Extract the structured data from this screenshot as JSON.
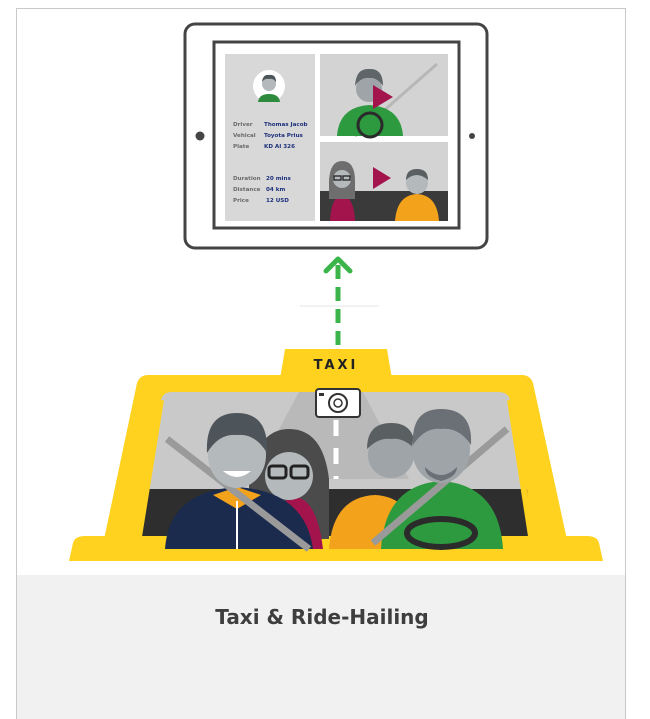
{
  "title": "Taxi & Ride-Hailing",
  "sign": "TAXI",
  "trip": {
    "driver_label": "Driver",
    "driver": "Thomas Jacob",
    "vehicle_label": "Vehical",
    "vehicle": "Toyota Prius",
    "plate_label": "Plate",
    "plate": "KD AI 326",
    "duration_label": "Duration",
    "duration": "20 mins",
    "distance_label": "Distance",
    "distance": "04 km",
    "price_label": "Price",
    "price": "12 USD"
  },
  "colors": {
    "taxi_yellow": "#ffd21f",
    "upload_arrow": "#3bb54a",
    "play": "#a3144d",
    "value_text": "#1c2f7b",
    "caption_bg": "#f1f1f1"
  }
}
